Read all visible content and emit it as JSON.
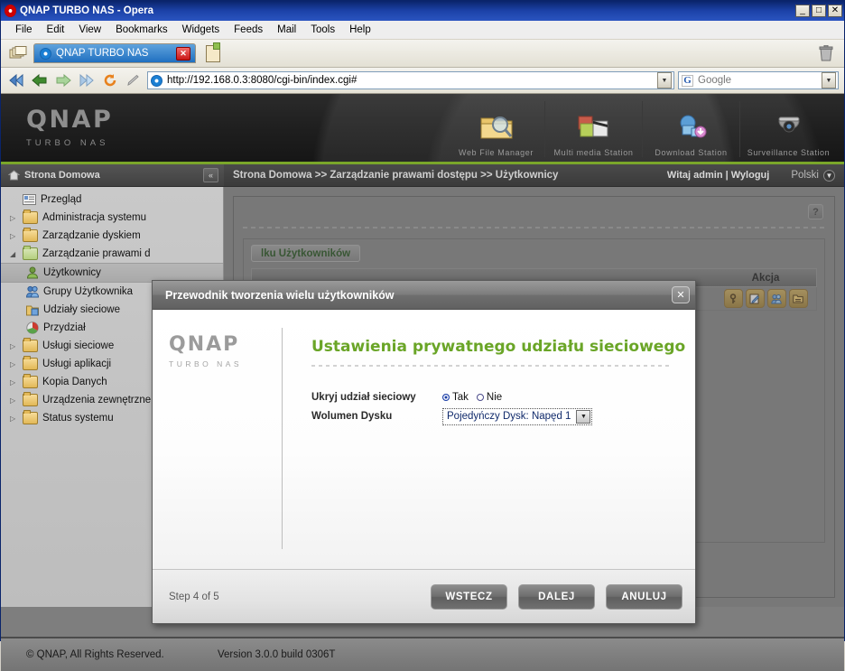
{
  "window": {
    "title": "QNAP TURBO NAS - Opera",
    "opera_icon": "opera-logo-icon",
    "minimize": "_",
    "maximize": "□",
    "close": "✕"
  },
  "menubar": {
    "items": [
      "File",
      "Edit",
      "View",
      "Bookmarks",
      "Widgets",
      "Feeds",
      "Mail",
      "Tools",
      "Help"
    ]
  },
  "tabbar": {
    "tab_label": "QNAP TURBO NAS",
    "tab_close": "✕",
    "newtab_icon": "new-page-icon",
    "trash_icon": "trash-icon"
  },
  "addressbar": {
    "url": "http://192.168.0.3:8080/cgi-bin/index.cgi#",
    "url_dropdown": "▼",
    "search_engine": "Google",
    "search_logo": "G",
    "search_dropdown": "▼",
    "nav_icons": [
      "rewind-icon",
      "back-icon",
      "forward-icon",
      "fast-forward-icon",
      "reload-icon",
      "edit-pen-icon"
    ]
  },
  "banner": {
    "brand": "QNAP",
    "subbrand": "TURBO NAS",
    "stations": [
      {
        "label": "Web File Manager",
        "icon": "web-file-manager-icon"
      },
      {
        "label": "Multi media Station",
        "icon": "multimedia-station-icon"
      },
      {
        "label": "Download Station",
        "icon": "download-station-icon"
      },
      {
        "label": "Surveillance Station",
        "icon": "surveillance-station-icon"
      }
    ]
  },
  "subbar": {
    "home_label": "Strona Domowa",
    "home_icon": "home-icon",
    "collapse_icon": "«",
    "breadcrumb": "Strona Domowa >> Zarządzanie prawami dostępu >> Użytkownicy",
    "welcome": "Witaj admin | Wyloguj",
    "language": "Polski",
    "language_arrow": "▼"
  },
  "sidebar": {
    "items": [
      {
        "label": "Przegląd",
        "icon": "overview-icon",
        "arrow": "",
        "level": 0,
        "selected": false
      },
      {
        "label": "Administracja systemu",
        "icon": "folder-icon",
        "arrow": "▷",
        "level": 0,
        "selected": false
      },
      {
        "label": "Zarządzanie dyskiem",
        "icon": "folder-icon",
        "arrow": "▷",
        "level": 0,
        "selected": false
      },
      {
        "label": "Zarządzanie prawami d",
        "icon": "folder-open-icon",
        "arrow": "◢",
        "level": 0,
        "selected": false
      },
      {
        "label": "Użytkownicy",
        "icon": "user-icon",
        "arrow": "",
        "level": 1,
        "selected": true
      },
      {
        "label": "Grupy Użytkownika",
        "icon": "user-group-icon",
        "arrow": "",
        "level": 1,
        "selected": false
      },
      {
        "label": "Udziały sieciowe",
        "icon": "network-share-icon",
        "arrow": "",
        "level": 1,
        "selected": false
      },
      {
        "label": "Przydział",
        "icon": "quota-icon",
        "arrow": "",
        "level": 1,
        "selected": false
      },
      {
        "label": "Usługi sieciowe",
        "icon": "folder-icon",
        "arrow": "▷",
        "level": 0,
        "selected": false
      },
      {
        "label": "Usługi aplikacji",
        "icon": "folder-icon",
        "arrow": "▷",
        "level": 0,
        "selected": false
      },
      {
        "label": "Kopia Danych",
        "icon": "folder-icon",
        "arrow": "▷",
        "level": 0,
        "selected": false
      },
      {
        "label": "Urządzenia zewnętrzne",
        "icon": "folder-icon",
        "arrow": "▷",
        "level": 0,
        "selected": false
      },
      {
        "label": "Status systemu",
        "icon": "folder-icon",
        "arrow": "▷",
        "level": 0,
        "selected": false
      }
    ]
  },
  "content": {
    "help_icon": "?",
    "create_button": "lku Użytkowników",
    "table_header_action": "Akcja",
    "action_icons": [
      "change-password-icon",
      "edit-icon",
      "user-groups-icon",
      "shared-folder-permission-icon"
    ]
  },
  "modal": {
    "title": "Przewodnik tworzenia wielu użytkowników",
    "close": "✕",
    "brand": "QNAP",
    "subbrand": "TURBO NAS",
    "heading": "Ustawienia prywatnego udziału sieciowego",
    "fields": {
      "hide_share_label": "Ukryj udział sieciowy",
      "radio_yes": "Tak",
      "radio_no": "Nie",
      "radio_selected": "Tak",
      "volume_label": "Wolumen Dysku",
      "volume_value": "Pojedyńczy Dysk: Napęd 1",
      "volume_arrow": "▼"
    },
    "step": "Step 4 of 5",
    "buttons": {
      "back": "WSTECZ",
      "next": "DALEJ",
      "cancel": "ANULUJ"
    }
  },
  "footer": {
    "copyright": "© QNAP, All Rights Reserved.",
    "version": "Version 3.0.0 build 0306T"
  },
  "colors": {
    "accent_green": "#6aa527",
    "banner_green": "#7aa62a",
    "titlebar_blue": "#0a246a"
  }
}
